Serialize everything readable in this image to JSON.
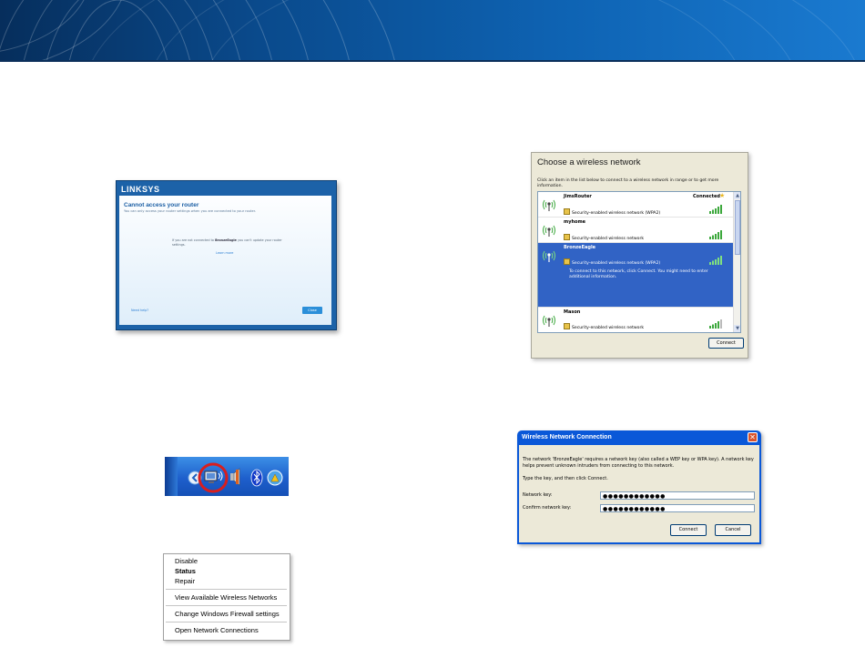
{
  "linksys_dialog": {
    "brand": "LINKSYS",
    "title": "Cannot access your router",
    "subtitle": "You can only access your router settings when you are connected to your router.",
    "message_pre": "If you are not connected to ",
    "message_network": "BronzeEagle",
    "message_post": " you can't update your router settings.",
    "learn_more": "Learn more",
    "need_help": "Need help?",
    "close_button": "Close"
  },
  "choose_network": {
    "title": "Choose a wireless network",
    "description": "Click an item in the list below to connect to a wireless network in range or to get more information.",
    "networks": [
      {
        "name": "JimsRouter",
        "security": "Security-enabled wireless network (WPA2)",
        "status": "Connected",
        "signal_bars": 5,
        "selected": false,
        "note": ""
      },
      {
        "name": "myhome",
        "security": "Security-enabled wireless network",
        "status": "",
        "signal_bars": 5,
        "selected": false,
        "note": ""
      },
      {
        "name": "BronzeEagle",
        "security": "Security-enabled wireless network (WPA2)",
        "status": "",
        "signal_bars": 5,
        "selected": true,
        "note": "To connect to this network, click Connect. You might need to enter additional information."
      },
      {
        "name": "Mason",
        "security": "Security-enabled wireless network",
        "status": "",
        "signal_bars": 4,
        "selected": false,
        "note": ""
      }
    ],
    "connect_button": "Connect"
  },
  "context_menu": {
    "items": [
      "Disable",
      "Status",
      "Repair",
      "View Available Wireless Networks",
      "Change Windows Firewall settings",
      "Open Network Connections"
    ]
  },
  "wireless_connection_dialog": {
    "title": "Wireless Network Connection",
    "description": "The network 'BronzeEagle' requires a network key (also called a WEP key or WPA key). A network key helps prevent unknown intruders from connecting to this network.",
    "instruction": "Type the key, and then click Connect.",
    "network_key_label": "Network key:",
    "network_key_value": "●●●●●●●●●●●●",
    "confirm_key_label": "Confirm network key:",
    "confirm_key_value": "●●●●●●●●●●●●",
    "connect_button": "Connect",
    "cancel_button": "Cancel"
  },
  "colors": {
    "header_dark": "#062e5c",
    "header_light": "#1a7ad0",
    "linksys_blue": "#1c62a8",
    "xp_titlebar": "#0a58d8",
    "xp_selection": "#3163c5",
    "highlight_circle": "#d81e1e"
  },
  "icons": [
    "wifi-antenna-icon",
    "lock-icon",
    "star-icon",
    "signal-bars-icon",
    "network-tray-icon",
    "volume-icon",
    "bluetooth-icon",
    "security-alert-icon",
    "chevron-left-icon",
    "close-icon"
  ]
}
